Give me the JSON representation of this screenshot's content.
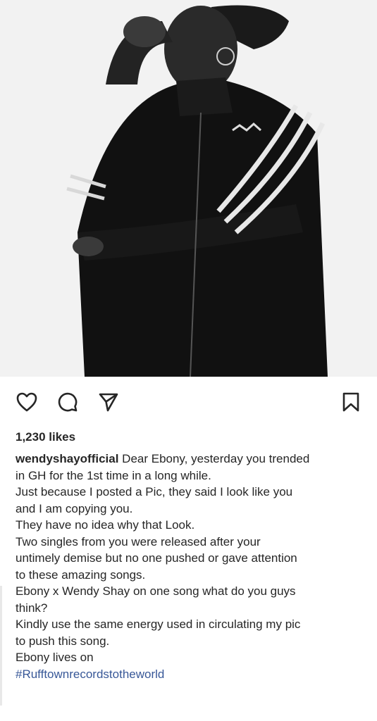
{
  "post": {
    "likes": "1,230 likes",
    "username": "wendyshayofficial",
    "caption_first": " Dear Ebony, yesterday you trended",
    "caption_lines": [
      "in GH for the 1st time in a long while.",
      "Just because I posted a Pic, they said I look like you",
      "and I am copying you.",
      "They have no idea why that Look.",
      "Two singles from you were released after your",
      "untimely demise but no one pushed or gave attention",
      "to these amazing songs.",
      "Ebony x Wendy Shay on one song what do you guys",
      "think?",
      "Kindly use the same energy used in circulating my pic",
      "to push this song.",
      "Ebony lives on"
    ],
    "hashtag": "#Rufftownrecordstotheworld"
  },
  "icons": {
    "like": "heart-icon",
    "comment": "comment-icon",
    "share": "paper-plane-icon",
    "save": "bookmark-icon"
  },
  "colors": {
    "text": "#262626",
    "hashtag": "#385898",
    "background": "#ffffff"
  }
}
